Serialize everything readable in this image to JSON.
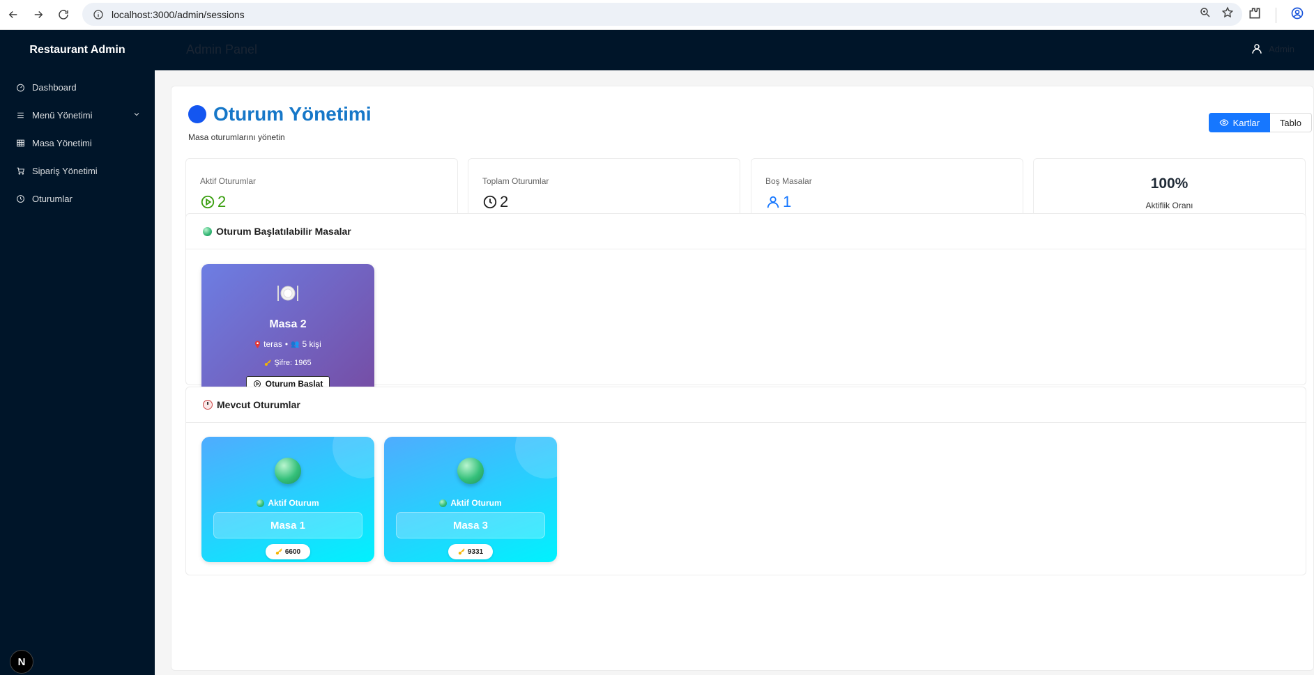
{
  "browser": {
    "url": "localhost:3000/admin/sessions"
  },
  "sidebar": {
    "brand": "Restaurant Admin",
    "items": [
      {
        "label": "Dashboard",
        "icon": "dashboard-icon"
      },
      {
        "label": "Menü Yönetimi",
        "icon": "menu-lines-icon"
      },
      {
        "label": "Masa Yönetimi",
        "icon": "table-grid-icon"
      },
      {
        "label": "Sipariş Yönetimi",
        "icon": "cart-icon"
      },
      {
        "label": "Oturumlar",
        "icon": "clock-icon"
      }
    ],
    "badge": "N"
  },
  "header": {
    "title": "Admin Panel",
    "user": "Admin"
  },
  "page": {
    "title": "Oturum Yönetimi",
    "subtitle": "Masa oturumlarını yönetin",
    "view_toggle": {
      "cards": "Kartlar",
      "table": "Tablo"
    }
  },
  "stats": [
    {
      "label": "Aktif Oturumlar",
      "value": "2",
      "color": "#389e0d",
      "icon": "play-circle-icon"
    },
    {
      "label": "Toplam Oturumlar",
      "value": "2",
      "color": "#1f1f1f",
      "icon": "clock-icon"
    },
    {
      "label": "Boş Masalar",
      "value": "1",
      "color": "#1677ff",
      "icon": "user-icon"
    }
  ],
  "rate": {
    "value": "100%",
    "label": "Aktiflik Oranı",
    "fraction": 1.0,
    "color": "#52c41a"
  },
  "available_section": {
    "title": "Oturum Başlatılabilir Masalar",
    "tables": [
      {
        "name": "Masa 2",
        "location": "teras",
        "capacity": "5 kişi",
        "password_label": "Şifre: 1965",
        "button": "Oturum Başlat"
      }
    ]
  },
  "sessions_section": {
    "title": "Mevcut Oturumlar",
    "sessions": [
      {
        "status": "Aktif Oturum",
        "name": "Masa 1",
        "code": "6600"
      },
      {
        "status": "Aktif Oturum",
        "name": "Masa 3",
        "code": "9331"
      }
    ]
  }
}
